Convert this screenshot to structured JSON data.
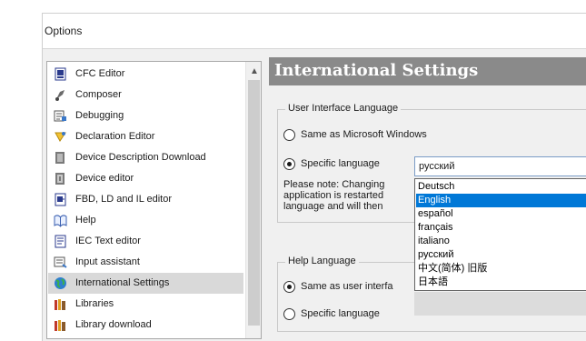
{
  "window": {
    "title": "Options"
  },
  "categories": [
    {
      "label": "CFC Editor",
      "icon": "cfc-editor-icon"
    },
    {
      "label": "Composer",
      "icon": "composer-icon"
    },
    {
      "label": "Debugging",
      "icon": "debugging-icon"
    },
    {
      "label": "Declaration Editor",
      "icon": "declaration-editor-icon"
    },
    {
      "label": "Device Description Download",
      "icon": "device-description-icon"
    },
    {
      "label": "Device editor",
      "icon": "device-editor-icon"
    },
    {
      "label": "FBD, LD and IL editor",
      "icon": "fbd-ld-il-icon"
    },
    {
      "label": "Help",
      "icon": "help-icon"
    },
    {
      "label": "IEC Text editor",
      "icon": "iec-text-editor-icon"
    },
    {
      "label": "Input assistant",
      "icon": "input-assistant-icon"
    },
    {
      "label": "International Settings",
      "icon": "globe-icon",
      "selected": true
    },
    {
      "label": "Libraries",
      "icon": "libraries-icon"
    },
    {
      "label": "Library download",
      "icon": "library-download-icon"
    }
  ],
  "panel": {
    "header": "International Settings",
    "ui_group": {
      "title": "User Interface Language",
      "same_as_windows": "Same as Microsoft Windows",
      "specific_language": "Specific language",
      "selected_language": "русский",
      "note": [
        "Please note: Changing",
        "application is restarted",
        "language and will then"
      ]
    },
    "language_options": [
      "Deutsch",
      "English",
      "español",
      "français",
      "italiano",
      "русский",
      "中文(简体) 旧版",
      "日本語"
    ],
    "highlighted_option": "English",
    "help_group": {
      "title": "Help Language",
      "same_as_ui": "Same as user interfa",
      "specific_language": "Specific language"
    }
  },
  "colors": {
    "selection": "#0078d7",
    "header": "#8a8a8a",
    "selected_row": "#d9d9d9"
  }
}
